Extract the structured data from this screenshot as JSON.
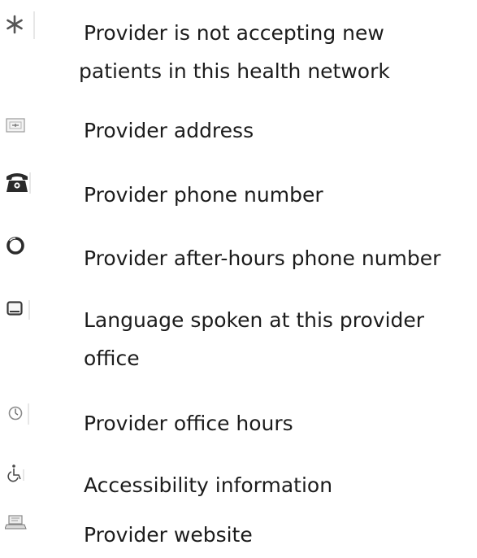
{
  "legend": {
    "items": [
      {
        "icon": "asterisk-icon",
        "line1": "Provider is not accepting new",
        "line2": "patients in this health network"
      },
      {
        "icon": "address-card-icon",
        "line1": "Provider address"
      },
      {
        "icon": "telephone-icon",
        "line1": "Provider phone number"
      },
      {
        "icon": "after-hours-circle-icon",
        "line1": "Provider after-hours phone number"
      },
      {
        "icon": "speech-bubble-icon",
        "line1": "Language spoken at this provider",
        "line2": "office"
      },
      {
        "icon": "clock-icon",
        "line1": "Provider office hours"
      },
      {
        "icon": "wheelchair-icon",
        "line1": "Accessibility information"
      },
      {
        "icon": "website-laptop-icon",
        "line1": "Provider website"
      }
    ]
  }
}
